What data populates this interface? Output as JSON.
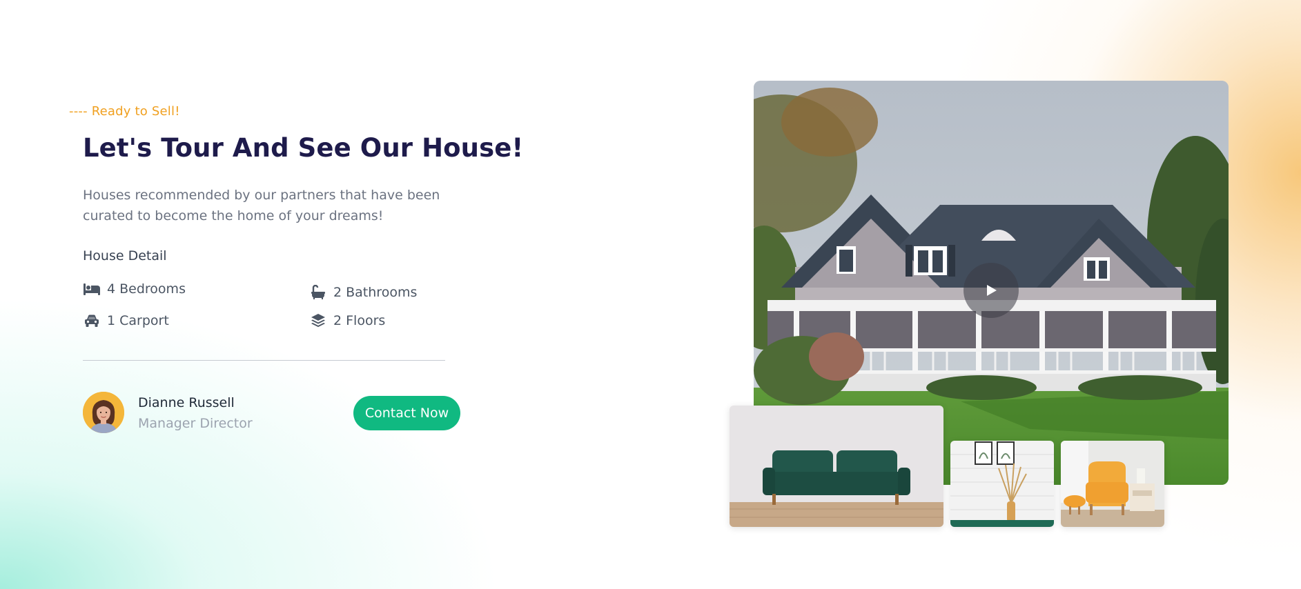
{
  "hero": {
    "tagline": "---- Ready to Sell!",
    "title": "Let's Tour And See Our House!",
    "description": "Houses recommended by our partners that have been curated to become the home of your dreams!"
  },
  "house_detail": {
    "heading": "House Detail",
    "features": [
      {
        "icon": "bed-icon",
        "label": "4 Bedrooms"
      },
      {
        "icon": "bathtub-icon",
        "label": "2 Bathrooms"
      },
      {
        "icon": "car-icon",
        "label": "1 Carport"
      },
      {
        "icon": "layers-icon",
        "label": "2 Floors"
      }
    ]
  },
  "agent": {
    "name": "Dianne Russell",
    "role": "Manager Director",
    "contact_label": "Contact Now"
  },
  "media": {
    "main_image": "house-exterior-photo",
    "play_icon": "play-icon",
    "thumbnails": [
      "sofa-living-room-photo",
      "wall-decor-photo",
      "armchair-photo"
    ]
  },
  "colors": {
    "accent_orange": "#f0a020",
    "title_navy": "#1e1b4b",
    "button_green": "#10b981",
    "text_gray": "#6b7280"
  }
}
